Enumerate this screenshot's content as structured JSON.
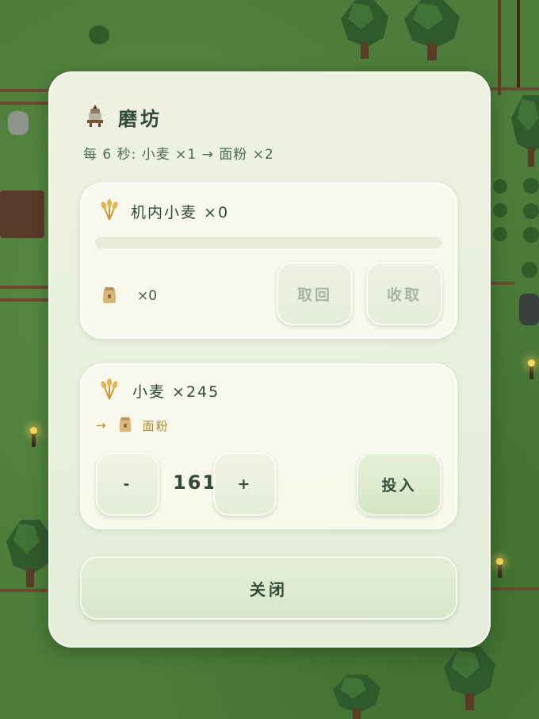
{
  "dialog": {
    "title": "磨坊",
    "icon": "millstone-icon",
    "rate_text": "每 6 秒: 小麦 ×1 → 面粉 ×2"
  },
  "machine": {
    "input_label": "机内小麦 ×0",
    "input_icon": "wheat-icon",
    "progress": 0,
    "output_icon": "flour-sack-icon",
    "output_count": "×0",
    "retrieve_label": "取回",
    "collect_label": "收取"
  },
  "deposit": {
    "stock_label": "小麦 ×245",
    "stock_icon": "wheat-icon",
    "arrow": "→",
    "product_icon": "flour-sack-icon",
    "product_label": "面粉",
    "minus_label": "-",
    "amount": "161",
    "plus_label": "+",
    "insert_label": "投入"
  },
  "close_label": "关闭",
  "colors": {
    "accent_green": "#d6e7cb",
    "text_dark": "#2f4a38",
    "gold_text": "#b08a2a"
  }
}
